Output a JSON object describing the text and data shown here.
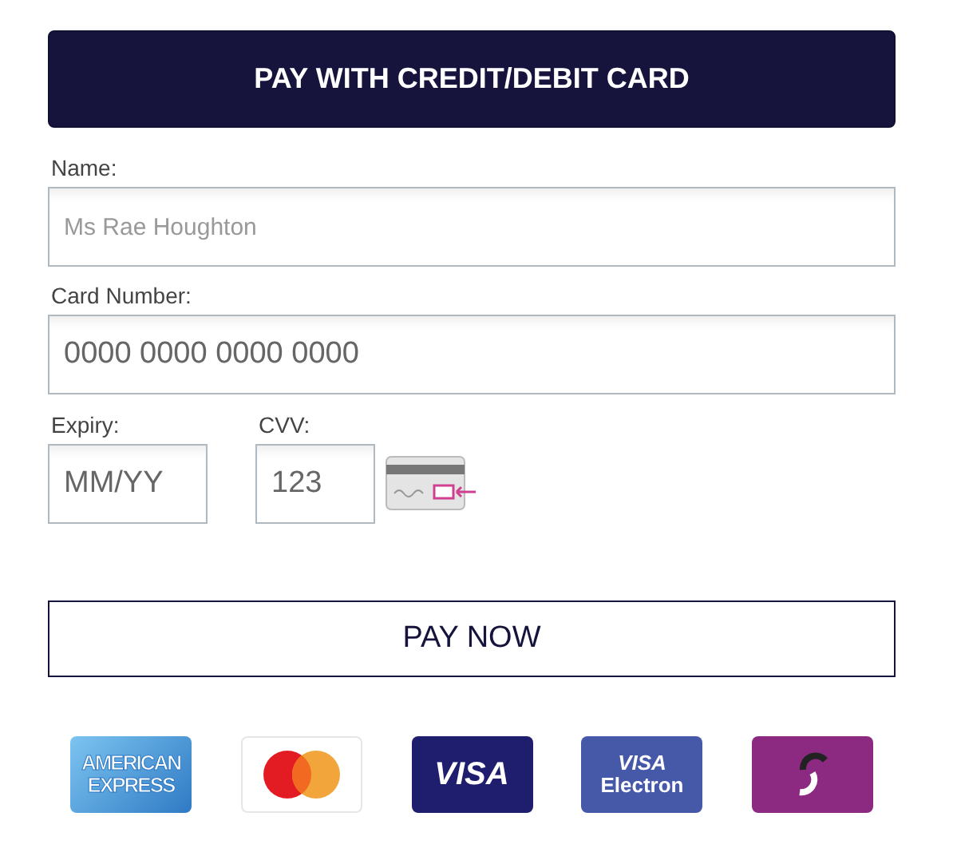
{
  "header_button": "PAY WITH CREDIT/DEBIT CARD",
  "fields": [
    {
      "label": "Name:",
      "placeholder": "Ms Rae Houghton",
      "kind": "text"
    },
    {
      "label": "Card Number:",
      "placeholder": "0000 0000 0000 0000",
      "kind": "number"
    }
  ],
  "expiry": {
    "label": "Expiry:",
    "placeholder": "MM/YY"
  },
  "cvv": {
    "label": "CVV:",
    "placeholder": "123"
  },
  "pay_button": "PAY NOW",
  "card_logos": [
    {
      "kind": "amex",
      "lines": [
        "AMERICAN",
        "EXPRESS"
      ]
    },
    {
      "kind": "mastercard"
    },
    {
      "kind": "visa",
      "lines": [
        "VISA"
      ]
    },
    {
      "kind": "electron",
      "lines": [
        "VISA",
        "Electron"
      ]
    },
    {
      "kind": "swirl"
    }
  ]
}
